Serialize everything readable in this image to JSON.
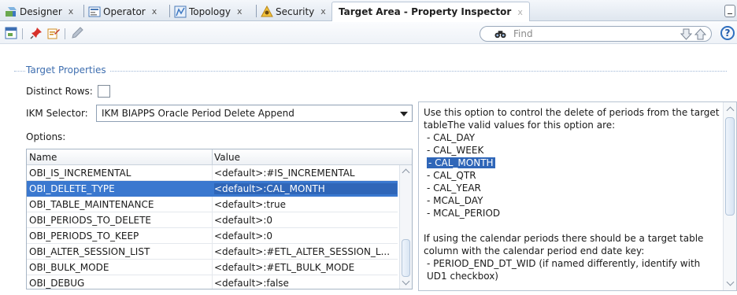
{
  "tabs": [
    {
      "label": "Designer",
      "icon": "designer-icon",
      "close": "x"
    },
    {
      "label": "Operator",
      "icon": "operator-icon",
      "close": "x"
    },
    {
      "label": "Topology",
      "icon": "topology-icon",
      "close": "x"
    },
    {
      "label": "Security",
      "icon": "security-icon",
      "close": "x"
    },
    {
      "label": "Target Area - Property Inspector",
      "icon": "",
      "close": "x",
      "active": true
    }
  ],
  "toolbar": {
    "icons": [
      "window-icon",
      "pin-icon",
      "edit-properties-icon",
      "pencil-icon"
    ],
    "find_placeholder": "Find",
    "help": "?"
  },
  "section": {
    "title": "Target Properties"
  },
  "distinct_rows": {
    "label": "Distinct Rows:",
    "checked": false
  },
  "ikm": {
    "label": "IKM Selector:",
    "value": "IKM BIAPPS Oracle Period Delete Append"
  },
  "options": {
    "label": "Options:",
    "columns": [
      "Name",
      "Value"
    ],
    "rows": [
      {
        "name": "OBI_IS_INCREMENTAL",
        "value": "<default>:#IS_INCREMENTAL"
      },
      {
        "name": "OBI_DELETE_TYPE",
        "value": "<default>:CAL_MONTH",
        "selected": true
      },
      {
        "name": "OBI_TABLE_MAINTENANCE",
        "value": "<default>:true"
      },
      {
        "name": "OBI_PERIODS_TO_DELETE",
        "value": "<default>:0"
      },
      {
        "name": "OBI_PERIODS_TO_KEEP",
        "value": "<default>:0"
      },
      {
        "name": "OBI_ALTER_SESSION_LIST",
        "value": "<default>:#ETL_ALTER_SESSION_L..."
      },
      {
        "name": "OBI_BULK_MODE",
        "value": "<default>:#ETL_BULK_MODE"
      },
      {
        "name": "OBI_DEBUG",
        "value": "<default>:false"
      }
    ]
  },
  "description": {
    "intro": "Use this option to control the delete of periods from the target tableThe valid values for this option are:",
    "values": [
      " - CAL_DAY",
      " - CAL_WEEK",
      " - CAL_MONTH",
      " - CAL_QTR",
      " - CAL_YEAR",
      " - MCAL_DAY",
      " - MCAL_PERIOD"
    ],
    "highlighted": " - CAL_MONTH",
    "para2": "If using the calendar periods there should be a target table column with the calendar period end date key:",
    "para3": "  - PERIOD_END_DT_WID (if named differently, identify with UD1 checkbox)"
  },
  "colors": {
    "accent": "#3a78cf",
    "section_title": "#3f6fb0"
  }
}
